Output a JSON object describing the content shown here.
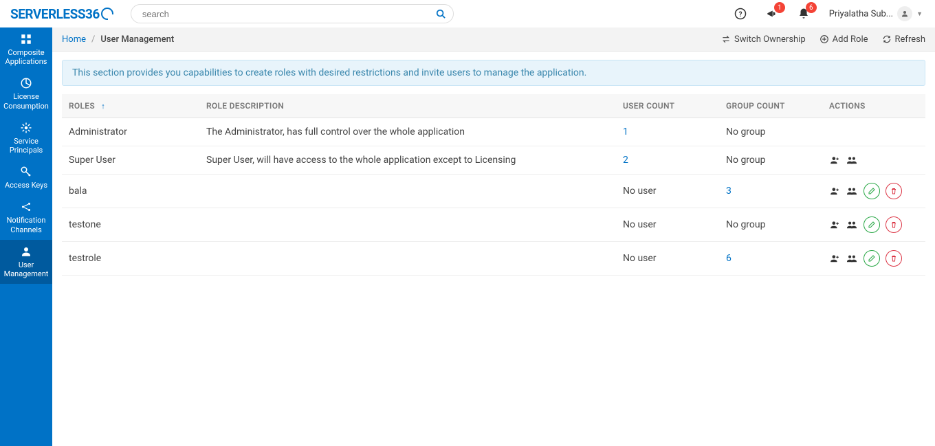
{
  "app": {
    "logo_text": "SERVERLESS36"
  },
  "search": {
    "placeholder": "search"
  },
  "header": {
    "ann_badge": "1",
    "bell_badge": "6",
    "username": "Priyalatha Sub..."
  },
  "sidebar": {
    "items": [
      {
        "label": "Composite Applications"
      },
      {
        "label": "License Consumption"
      },
      {
        "label": "Service Principals"
      },
      {
        "label": "Access Keys"
      },
      {
        "label": "Notification Channels"
      },
      {
        "label": "User Management"
      }
    ]
  },
  "breadcrumb": {
    "home": "Home",
    "current": "User Management"
  },
  "sub_actions": {
    "switch": "Switch Ownership",
    "add_role": "Add Role",
    "refresh": "Refresh"
  },
  "banner": "This section provides you capabilities to create roles with desired restrictions and invite users to manage the application.",
  "columns": {
    "roles": "ROLES",
    "desc": "ROLE DESCRIPTION",
    "user_count": "USER COUNT",
    "group_count": "GROUP COUNT",
    "actions": "ACTIONS"
  },
  "rows": [
    {
      "role": "Administrator",
      "desc": "The Administrator, has full control over the whole application",
      "user_count": "1",
      "user_link": true,
      "group_count": "No group",
      "group_link": false,
      "actions": "none"
    },
    {
      "role": "Super User",
      "desc": "Super User, will have access to the whole application except to Licensing",
      "user_count": "2",
      "user_link": true,
      "group_count": "No group",
      "group_link": false,
      "actions": "basic"
    },
    {
      "role": "bala",
      "desc": "",
      "user_count": "No user",
      "user_link": false,
      "group_count": "3",
      "group_link": true,
      "actions": "full"
    },
    {
      "role": "testone",
      "desc": "",
      "user_count": "No user",
      "user_link": false,
      "group_count": "No group",
      "group_link": false,
      "actions": "full"
    },
    {
      "role": "testrole",
      "desc": "",
      "user_count": "No user",
      "user_link": false,
      "group_count": "6",
      "group_link": true,
      "actions": "full"
    }
  ]
}
